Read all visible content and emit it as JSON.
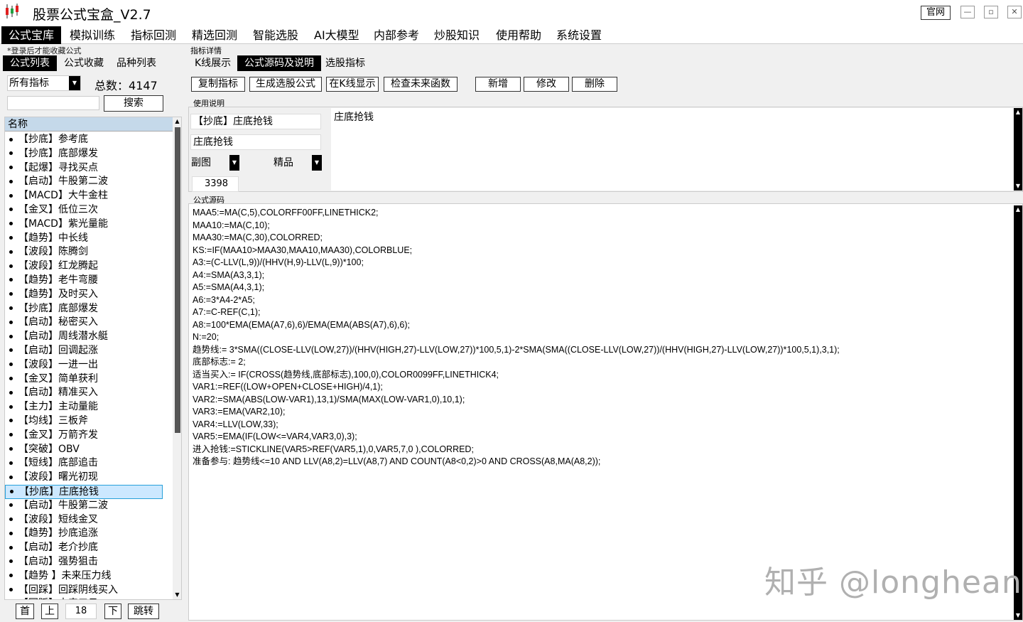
{
  "app": {
    "title": "股票公式宝盒_V2.7",
    "official_label": "官网",
    "win_minimize": "—",
    "win_restore": "▫",
    "win_close": "✕"
  },
  "menu": [
    "公式宝库",
    "模拟训练",
    "指标回测",
    "精选回测",
    "智能选股",
    "AI大模型",
    "内部参考",
    "炒股知识",
    "使用帮助",
    "系统设置"
  ],
  "left": {
    "login_tip": "*登录后才能收藏公式",
    "tabs": [
      "公式列表",
      "公式收藏",
      "品种列表"
    ],
    "select_value": "所有指标",
    "total_label": "总数：",
    "total_value": "4147",
    "search_value": "",
    "search_button": "搜索",
    "list_header": "名称",
    "items": [
      "【抄底】参考底",
      "【抄底】底部爆发",
      "【起爆】寻找买点",
      "【启动】牛股第二波",
      "【MACD】大牛金柱",
      "【金叉】低位三次",
      "【MACD】紫光量能",
      "【趋势】中长线",
      "【波段】陈腾剑",
      "【波段】红龙腾起",
      "【趋势】老牛弯腰",
      "【趋势】及时买入",
      "【抄底】底部爆发",
      "【启动】秘密买入",
      "【启动】周线潜水艇",
      "【启动】回调起涨",
      "【波段】一进一出",
      "【金叉】简单获利",
      "【启动】精准买入",
      "【主力】主动量能",
      "【均线】三板斧",
      "【金叉】万箭齐发",
      "【突破】OBV",
      "【短线】底部追击",
      "【波段】曙光初现",
      "【抄底】庄底抢钱",
      "【启动】牛股第二波",
      "【波段】短线金叉",
      "【趋势】抄底追涨",
      "【启动】老介抄底",
      "【启动】强势狙击",
      "【趋势 】未来压力线",
      "【回踩】回踩阴线买入",
      "【回踩】未来三日"
    ],
    "selected_index": 25,
    "pager": {
      "first": "首",
      "prev": "上",
      "page": "18",
      "next": "下",
      "jump": "跳转"
    }
  },
  "right": {
    "detail_label": "指标详情",
    "tabs": [
      "K线展示",
      "公式源码及说明",
      "选股指标"
    ],
    "buttons": [
      "复制指标",
      "生成选股公式",
      "在K线显示",
      "检查未来函数",
      "新增",
      "修改",
      "删除"
    ],
    "usage_label": "使用说明",
    "name_field": "【抄底】庄底抢钱",
    "short_name": "庄底抢钱",
    "chart_type": "副图",
    "quality": "精品",
    "id_value": "3398",
    "description": "庄底抢钱",
    "source_label": "公式源码",
    "source_lines": [
      "MAA5:=MA(C,5),COLORFF00FF,LINETHICK2;",
      "MAA10:=MA(C,10);",
      "MAA30:=MA(C,30),COLORRED;",
      "KS:=IF(MAA10>MAA30,MAA10,MAA30),COLORBLUE;",
      "A3:=(C-LLV(L,9))/(HHV(H,9)-LLV(L,9))*100;",
      "A4:=SMA(A3,3,1);",
      "A5:=SMA(A4,3,1);",
      "A6:=3*A4-2*A5;",
      "A7:=C-REF(C,1);",
      "A8:=100*EMA(EMA(A7,6),6)/EMA(EMA(ABS(A7),6),6);",
      "N:=20;",
      "趋势线:= 3*SMA((CLOSE-LLV(LOW,27))/(HHV(HIGH,27)-LLV(LOW,27))*100,5,1)-2*SMA(SMA((CLOSE-LLV(LOW,27))/(HHV(HIGH,27)-LLV(LOW,27))*100,5,1),3,1);",
      "底部标志:= 2;",
      "适当买入:= IF(CROSS(趋势线,底部标志),100,0),COLOR0099FF,LINETHICK4;",
      "VAR1:=REF((LOW+OPEN+CLOSE+HIGH)/4,1);",
      "VAR2:=SMA(ABS(LOW-VAR1),13,1)/SMA(MAX(LOW-VAR1,0),10,1);",
      "VAR3:=EMA(VAR2,10);",
      "VAR4:=LLV(LOW,33);",
      "VAR5:=EMA(IF(LOW<=VAR4,VAR3,0),3);",
      "进入抢钱:=STICKLINE(VAR5>REF(VAR5,1),0,VAR5,7,0 ),COLORRED;",
      "准备参与: 趋势线<=10 AND LLV(A8,2)=LLV(A8,7) AND COUNT(A8<0,2)>0 AND CROSS(A8,MA(A8,2));"
    ],
    "watermark": "知乎 @longhean"
  }
}
